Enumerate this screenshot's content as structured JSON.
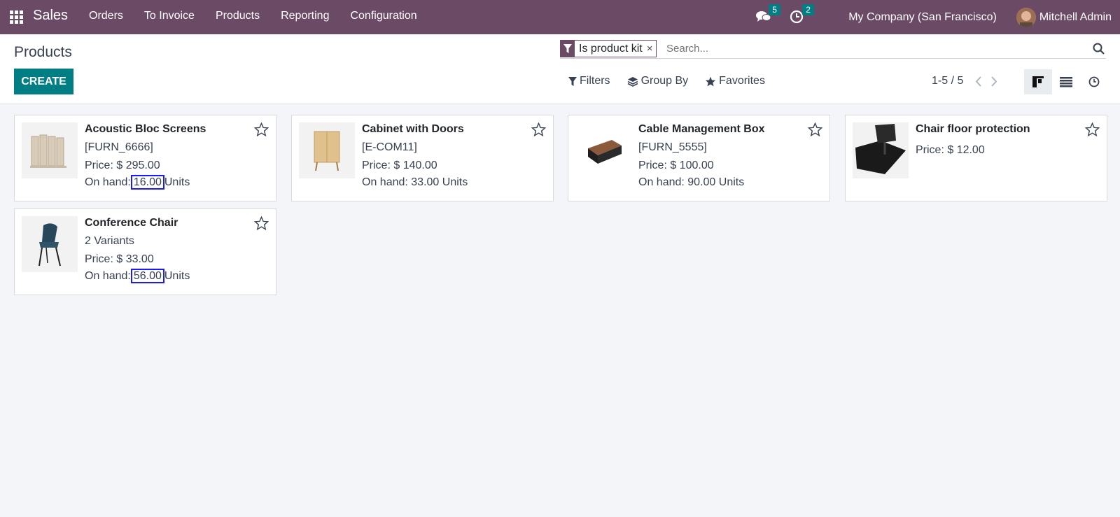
{
  "navbar": {
    "app_name": "Sales",
    "menu": [
      "Orders",
      "To Invoice",
      "Products",
      "Reporting",
      "Configuration"
    ],
    "messages_count": "5",
    "activities_count": "2",
    "company": "My Company (San Francisco)",
    "user": "Mitchell Admin"
  },
  "control_panel": {
    "title": "Products",
    "create_label": "CREATE",
    "facet_label": "Is product kit",
    "facet_close": "×",
    "search_placeholder": "Search...",
    "filters_label": "Filters",
    "group_by_label": "Group By",
    "favorites_label": "Favorites",
    "pager": "1-5 / 5"
  },
  "products": [
    {
      "name": "Acoustic Bloc Screens",
      "ref": "[FURN_6666]",
      "price": "Price: $ 295.00",
      "onhand_prefix": "On hand:",
      "onhand_value": "16.00",
      "onhand_unit": "Units"
    },
    {
      "name": "Cabinet with Doors",
      "ref": "[E-COM11]",
      "price": "Price: $ 140.00",
      "onhand_prefix": "On hand:",
      "onhand_value": "33.00",
      "onhand_unit": "Units"
    },
    {
      "name": "Cable Management Box",
      "ref": "[FURN_5555]",
      "price": "Price: $ 100.00",
      "onhand_prefix": "On hand:",
      "onhand_value": "90.00",
      "onhand_unit": "Units"
    },
    {
      "name": "Chair floor protection",
      "price": "Price: $ 12.00"
    },
    {
      "name": "Conference Chair",
      "ref": "2 Variants",
      "price": "Price: $ 33.00",
      "onhand_prefix": "On hand:",
      "onhand_value": "56.00",
      "onhand_unit": "Units"
    }
  ],
  "colors": {
    "navbar": "#6b4a66",
    "primary": "#017e84",
    "highlight": "#1a1aff"
  }
}
